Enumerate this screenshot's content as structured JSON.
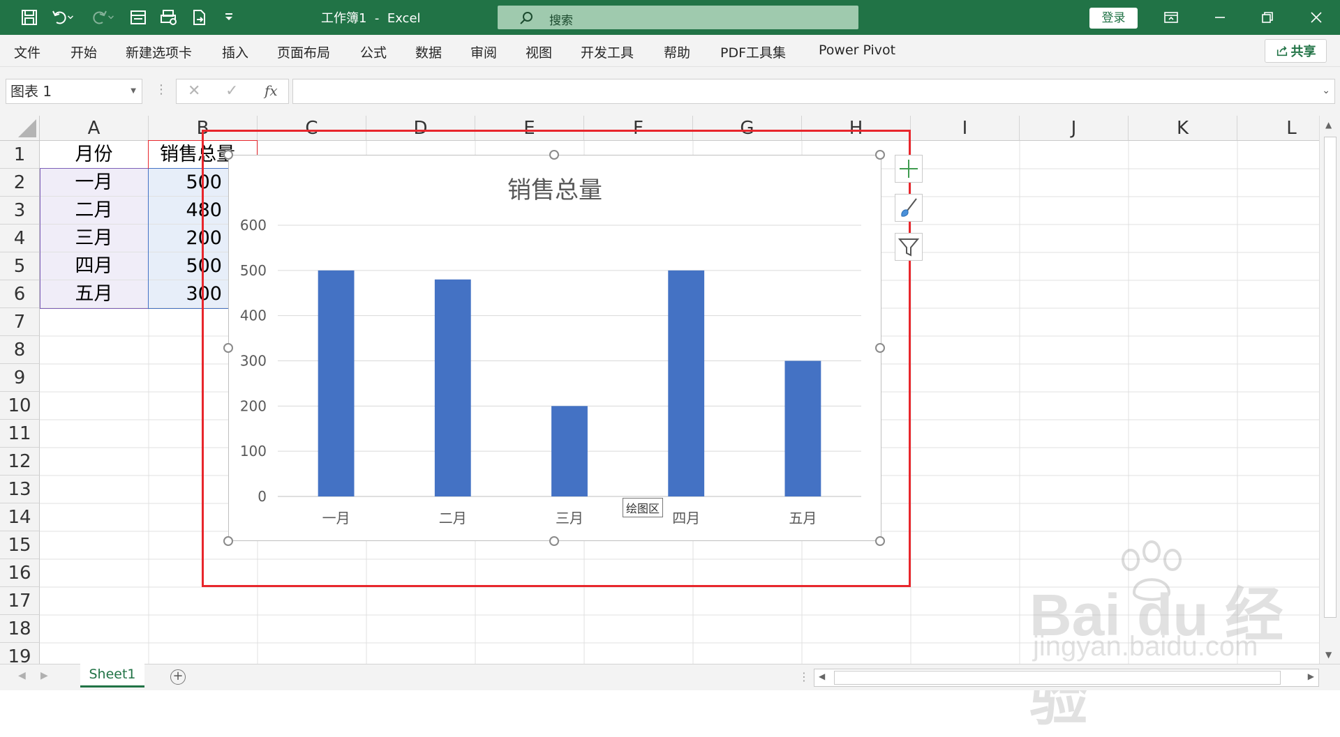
{
  "app": {
    "title": "工作簿1  -  Excel",
    "search_placeholder": "搜索",
    "login_label": "登录"
  },
  "menu": {
    "items": [
      "文件",
      "开始",
      "新建选项卡",
      "插入",
      "页面布局",
      "公式",
      "数据",
      "审阅",
      "视图",
      "开发工具",
      "帮助",
      "PDF工具集",
      "Power Pivot"
    ],
    "share_label": "共享"
  },
  "formula_bar": {
    "name_box": "图表 1",
    "fx_label": "fx",
    "formula": ""
  },
  "grid": {
    "columns": [
      "A",
      "B",
      "C",
      "D",
      "E",
      "F",
      "G",
      "H",
      "I",
      "J",
      "K",
      "L"
    ],
    "rows": [
      "1",
      "2",
      "3",
      "4",
      "5",
      "6",
      "7",
      "8",
      "9",
      "10",
      "11",
      "12",
      "13",
      "14",
      "15",
      "16",
      "17",
      "18",
      "19"
    ],
    "cells": [
      [
        "月份",
        "销售总量"
      ],
      [
        "一月",
        "500"
      ],
      [
        "二月",
        "480"
      ],
      [
        "三月",
        "200"
      ],
      [
        "四月",
        "500"
      ],
      [
        "五月",
        "300"
      ]
    ]
  },
  "chart_data": {
    "type": "bar",
    "title": "销售总量",
    "categories": [
      "一月",
      "二月",
      "三月",
      "四月",
      "五月"
    ],
    "values": [
      500,
      480,
      200,
      500,
      300
    ],
    "ylim": [
      0,
      600
    ],
    "yticks": [
      0,
      100,
      200,
      300,
      400,
      500,
      600
    ],
    "xlabel": "",
    "ylabel": "",
    "grid": true,
    "bar_color": "#4472c4"
  },
  "chart_ui": {
    "plot_area_tooltip": "绘图区"
  },
  "sheets": {
    "tabs": [
      "Sheet1"
    ],
    "add_label": "+"
  },
  "colors": {
    "excel_green": "#217346",
    "highlight_red": "#e8262c"
  },
  "watermark": {
    "line1": "Bai du 经验",
    "line2": "jingyan.baidu.com"
  }
}
